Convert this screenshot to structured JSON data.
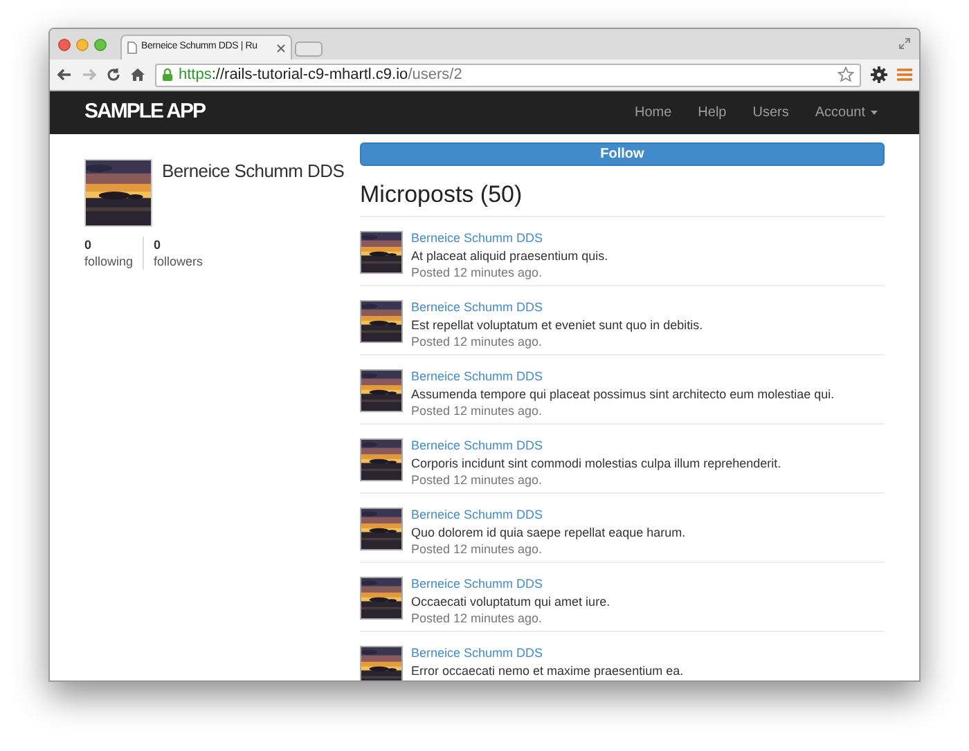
{
  "browser": {
    "tab_title": "Berneice Schumm DDS | Ru",
    "url_scheme": "https",
    "url_rest": "://rails-tutorial-c9-mhartl.c9.io",
    "url_path": "/users/2"
  },
  "navbar": {
    "logo": "SAMPLE APP",
    "links": [
      {
        "label": "Home",
        "kind": "link"
      },
      {
        "label": "Help",
        "kind": "link"
      },
      {
        "label": "Users",
        "kind": "link"
      },
      {
        "label": "Account",
        "kind": "dropdown"
      }
    ]
  },
  "profile": {
    "name": "Berneice Schumm DDS",
    "stats": [
      {
        "count": "0",
        "label": "following"
      },
      {
        "count": "0",
        "label": "followers"
      }
    ]
  },
  "follow_button": "Follow",
  "heading": "Microposts (50)",
  "microposts": [
    {
      "user": "Berneice Schumm DDS",
      "content": "At placeat aliquid praesentium quis.",
      "timestamp": "Posted 12 minutes ago."
    },
    {
      "user": "Berneice Schumm DDS",
      "content": "Est repellat voluptatum et eveniet sunt quo in debitis.",
      "timestamp": "Posted 12 minutes ago."
    },
    {
      "user": "Berneice Schumm DDS",
      "content": "Assumenda tempore qui placeat possimus sint architecto eum molestiae qui.",
      "timestamp": "Posted 12 minutes ago."
    },
    {
      "user": "Berneice Schumm DDS",
      "content": "Corporis incidunt sint commodi molestias culpa illum reprehenderit.",
      "timestamp": "Posted 12 minutes ago."
    },
    {
      "user": "Berneice Schumm DDS",
      "content": "Quo dolorem id quia saepe repellat eaque harum.",
      "timestamp": "Posted 12 minutes ago."
    },
    {
      "user": "Berneice Schumm DDS",
      "content": "Occaecati voluptatum qui amet iure.",
      "timestamp": "Posted 12 minutes ago."
    },
    {
      "user": "Berneice Schumm DDS",
      "content": "Error occaecati nemo et maxime praesentium ea."
    }
  ]
}
